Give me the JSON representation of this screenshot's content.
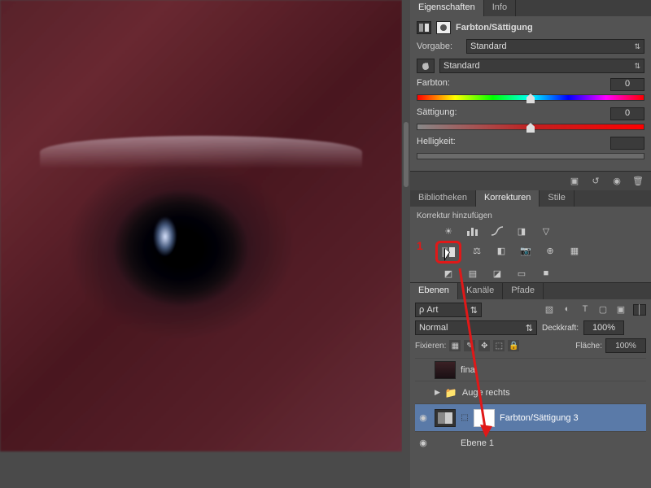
{
  "properties_panel": {
    "tabs": {
      "eigenschaften": "Eigenschaften",
      "info": "Info"
    },
    "adjustment_title": "Farbton/Sättigung",
    "preset_label": "Vorgabe:",
    "preset_value": "Standard",
    "channel_value": "Standard",
    "sliders": {
      "hue": {
        "label": "Farbton:",
        "value": "0"
      },
      "sat": {
        "label": "Sättigung:",
        "value": "0"
      },
      "lig": {
        "label": "Helligkeit:",
        "value": ""
      }
    },
    "footer_icons": [
      "clip-icon",
      "reset-icon",
      "visibility-icon",
      "trash-icon"
    ]
  },
  "corrections_panel": {
    "tabs": {
      "bibliotheken": "Bibliotheken",
      "korrekturen": "Korrekturen",
      "stile": "Stile"
    },
    "subtitle": "Korrektur hinzufügen",
    "highlight_number": "1",
    "icons": {
      "row1": [
        "brightness-contrast-icon",
        "levels-icon",
        "curves-icon",
        "exposure-icon",
        "vibrance-icon"
      ],
      "row2": [
        "hue-saturation-icon",
        "color-balance-icon",
        "black-white-icon",
        "photo-filter-icon",
        "channel-mixer-icon",
        "lookup-icon"
      ],
      "row3": [
        "invert-icon",
        "posterize-icon",
        "threshold-icon",
        "gradient-map-icon",
        "selective-color-icon"
      ]
    }
  },
  "layers_panel": {
    "tabs": {
      "ebenen": "Ebenen",
      "kanaele": "Kanäle",
      "pfade": "Pfade"
    },
    "filter_mode_prefix": "ρ",
    "filter_mode": "Art",
    "blend_mode": "Normal",
    "opacity_label": "Deckkraft:",
    "opacity_value": "100%",
    "lock_label": "Fixieren:",
    "fill_label": "Fläche:",
    "fill_value": "100%",
    "layers": [
      {
        "name": "final",
        "visible": false,
        "type": "image"
      },
      {
        "name": "Auge rechts",
        "visible": false,
        "type": "group"
      },
      {
        "name": "Farbton/Sättigung 3",
        "visible": true,
        "type": "adjustment",
        "selected": true
      },
      {
        "name": "Ebene 1",
        "visible": true,
        "type": "image"
      }
    ]
  }
}
